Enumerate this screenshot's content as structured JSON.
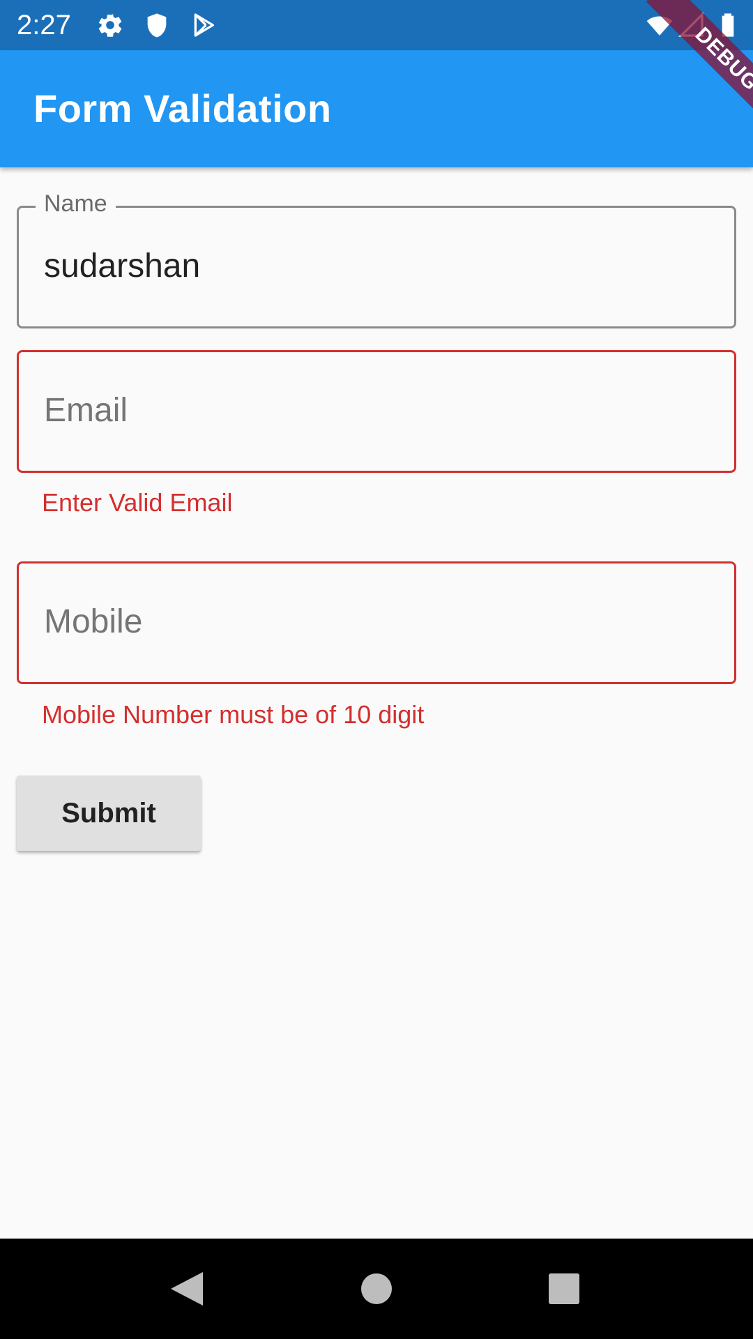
{
  "status_bar": {
    "time": "2:27",
    "left_icons": [
      "gear-icon",
      "shield-icon",
      "play-store-icon"
    ],
    "right_icons": [
      "wifi-icon",
      "cell-signal-icon",
      "battery-icon"
    ],
    "background_color": "#1b6fb8"
  },
  "debug_banner": {
    "label": "DEBUG",
    "color": "#881337"
  },
  "app_bar": {
    "title": "Form Validation",
    "background_color": "#2196f3"
  },
  "form": {
    "name": {
      "label": "Name",
      "value": "sudarshan"
    },
    "email": {
      "hint": "Email",
      "value": "",
      "error": "Enter Valid Email"
    },
    "mobile": {
      "hint": "Mobile",
      "value": "",
      "error": "Mobile Number must be of 10 digit"
    },
    "submit_label": "Submit"
  },
  "colors": {
    "error": "#d32f2f",
    "page_background": "#fafafa"
  },
  "nav_bar": {
    "icons": [
      "back-icon",
      "home-icon",
      "recents-icon"
    ]
  }
}
